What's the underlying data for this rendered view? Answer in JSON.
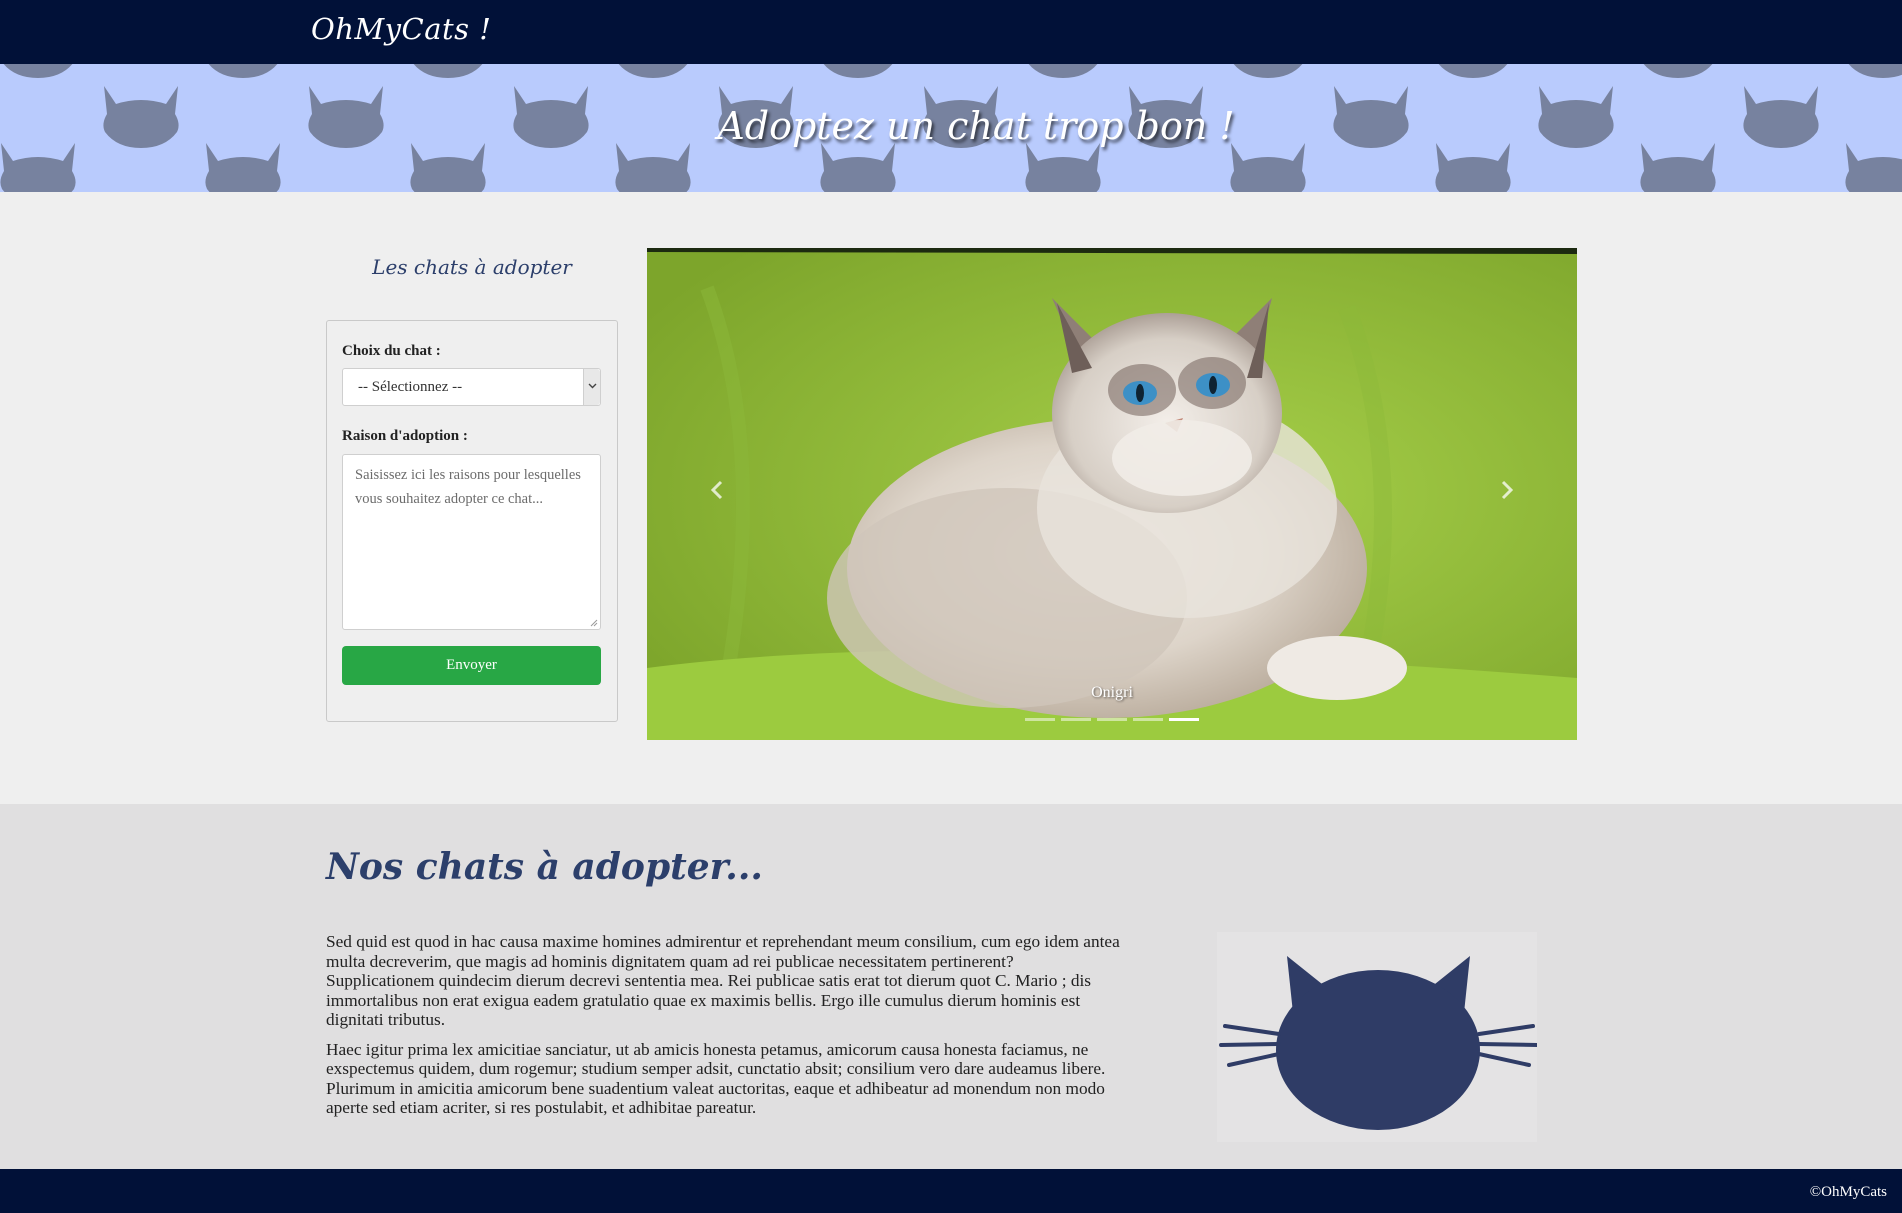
{
  "navbar": {
    "brand": "OhMyCats !"
  },
  "hero": {
    "title": "Adoptez un chat trop bon !"
  },
  "sidebar": {
    "title": "Les chats à adopter",
    "form": {
      "cat_label": "Choix du chat :",
      "cat_select_value": "-- Sélectionnez --",
      "reason_label": "Raison d'adoption :",
      "reason_placeholder": "Saisissez ici les raisons pour lesquelles vous souhaitez adopter ce chat...",
      "submit_label": "Envoyer"
    }
  },
  "carousel": {
    "caption": "Onigri",
    "slide_count": 5,
    "active_index": 4,
    "prev_icon": "chevron-left-icon",
    "next_icon": "chevron-right-icon"
  },
  "about": {
    "title": "Nos chats à adopter...",
    "paragraphs": [
      "Sed quid est quod in hac causa maxime homines admirentur et reprehendant meum consilium, cum ego idem antea multa decreverim, que magis ad hominis dignitatem quam ad rei publicae necessitatem pertinerent? Supplicationem quindecim dierum decrevi sententia mea. Rei publicae satis erat tot dierum quot C. Mario ; dis immortalibus non erat exigua eadem gratulatio quae ex maximis bellis. Ergo ille cumulus dierum hominis est dignitati tributus.",
      "Haec igitur prima lex amicitiae sanciatur, ut ab amicis honesta petamus, amicorum causa honesta faciamus, ne exspectemus quidem, dum rogemur; studium semper adsit, cunctatio absit; consilium vero dare audeamus libere. Plurimum in amicitia amicorum bene suadentium valeat auctoritas, eaque et adhibeatur ad monendum non modo aperte sed etiam acriter, si res postulabit, et adhibitae pareatur."
    ],
    "illustration_icon": "cat-face-icon"
  },
  "footer": {
    "copyright": "©OhMyCats"
  },
  "colors": {
    "navbar": "#011138",
    "hero_bg": "#b9cbfd",
    "hero_cat": "#77829f",
    "accent_title": "#2c3f6b",
    "submit": "#28a745",
    "cat_illustration": "#2f3c66"
  }
}
